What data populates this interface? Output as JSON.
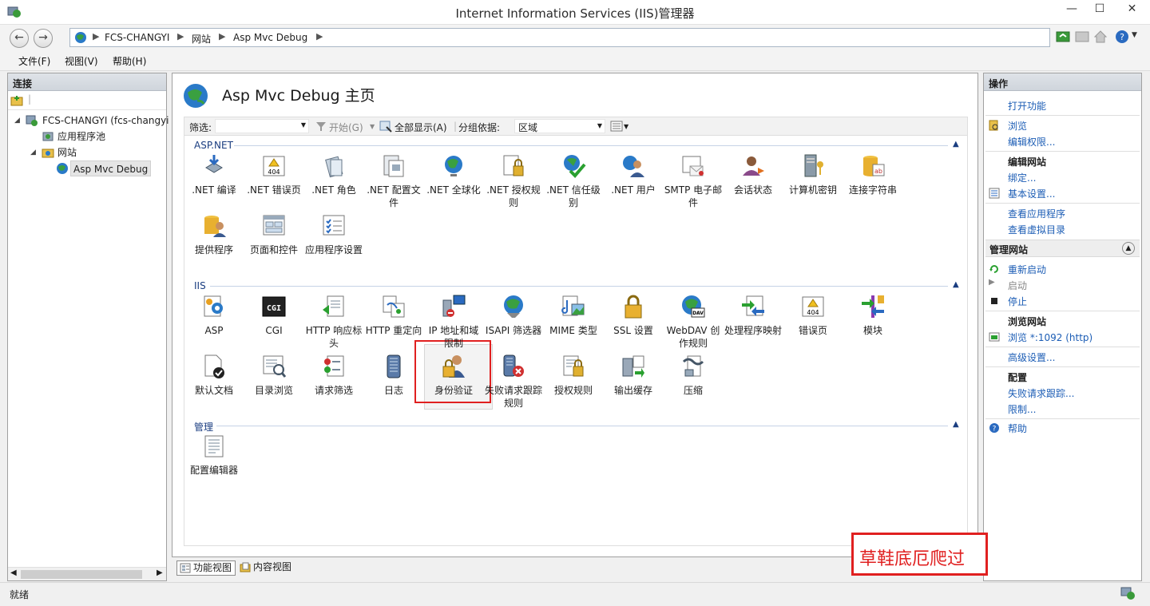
{
  "window": {
    "title": "Internet Information Services (IIS)管理器"
  },
  "address": {
    "crumbs": [
      "FCS-CHANGYI",
      "网站",
      "Asp Mvc Debug"
    ]
  },
  "menu": {
    "items": [
      "文件(F)",
      "视图(V)",
      "帮助(H)"
    ]
  },
  "connections": {
    "header": "连接",
    "tree": {
      "server": "FCS-CHANGYI (fcs-changyi",
      "app_pools": "应用程序池",
      "sites": "网站",
      "site": "Asp Mvc Debug"
    }
  },
  "center": {
    "title": "Asp Mvc Debug 主页",
    "filter": {
      "label": "筛选:",
      "start": "开始(G)",
      "show_all": "全部显示(A)",
      "group_by": "分组依据:",
      "group_value": "区域"
    },
    "groups": [
      {
        "label": "ASP.NET",
        "features": [
          ".NET 编译",
          ".NET 错误页",
          ".NET 角色",
          ".NET 配置文件",
          ".NET 全球化",
          ".NET 授权规则",
          ".NET 信任级别",
          ".NET 用户",
          "SMTP 电子邮件",
          "会话状态",
          "计算机密钥",
          "连接字符串",
          "提供程序",
          "页面和控件",
          "应用程序设置"
        ]
      },
      {
        "label": "IIS",
        "features": [
          "ASP",
          "CGI",
          "HTTP 响应标头",
          "HTTP 重定向",
          "IP 地址和域限制",
          "ISAPI 筛选器",
          "MIME 类型",
          "SSL 设置",
          "WebDAV 创作规则",
          "处理程序映射",
          "错误页",
          "模块",
          "默认文档",
          "目录浏览",
          "请求筛选",
          "日志",
          "身份验证",
          "失败请求跟踪规则",
          "授权规则",
          "输出缓存",
          "压缩"
        ]
      },
      {
        "label": "管理",
        "features": [
          "配置编辑器"
        ]
      }
    ],
    "cgi_icon_text": "CGI",
    "error_icon_text": "404",
    "webdav_icon_text": "DAV"
  },
  "view_tabs": {
    "feature_view": "功能视图",
    "content_view": "内容视图"
  },
  "actions": {
    "header": "操作",
    "open_feature": "打开功能",
    "browse": "浏览",
    "edit_permissions": "编辑权限...",
    "edit_site_head": "编辑网站",
    "bindings": "绑定...",
    "basic_settings": "基本设置...",
    "view_apps": "查看应用程序",
    "view_vdirs": "查看虚拟目录",
    "manage_site": "管理网站",
    "restart": "重新启动",
    "start": "启动",
    "stop": "停止",
    "browse_site_head": "浏览网站",
    "browse_port": "浏览 *:1092 (http)",
    "advanced_settings": "高级设置...",
    "config_head": "配置",
    "failed_tracing": "失败请求跟踪...",
    "limits": "限制...",
    "help": "帮助"
  },
  "status": {
    "text": "就绪"
  },
  "watermark": {
    "text": "草鞋底厄爬过"
  },
  "colors": {
    "link": "#1c5db5",
    "highlight": "#e02020",
    "group_label": "#1a3d80"
  }
}
